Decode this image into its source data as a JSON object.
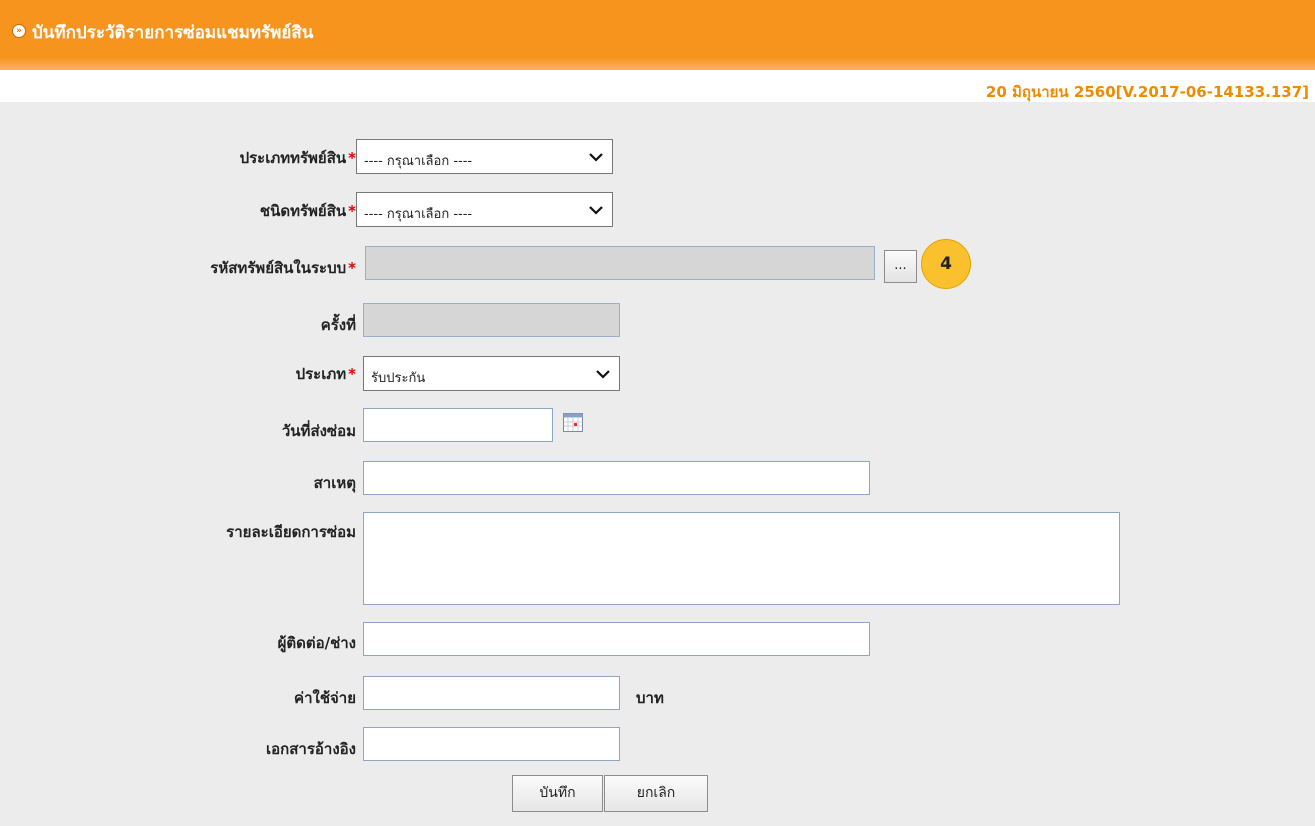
{
  "header": {
    "title": "บันทึกประวัติรายการซ่อมแชมทรัพย์สิน",
    "version": "20 มิถุนายน 2560[V.2017-06-14133.137]"
  },
  "form": {
    "asset_type": {
      "label": "ประเภททรัพย์สิน",
      "required_mark": "*",
      "value": "---- กรุณาเลือก ----"
    },
    "asset_kind": {
      "label": "ชนิดทรัพย์สิน",
      "required_mark": "*",
      "value": "---- กรุณาเลือก ----"
    },
    "asset_code": {
      "label": "รหัสทรัพย์สินในระบบ",
      "required_mark": "*",
      "value": "",
      "browse_label": "...",
      "step_badge": "4"
    },
    "times": {
      "label": "ครั้งที่",
      "value": ""
    },
    "category": {
      "label": "ประเภท",
      "required_mark": "*",
      "value": "รับประกัน"
    },
    "send_date": {
      "label": "วันที่ส่งซ่อม",
      "value": ""
    },
    "cause": {
      "label": "สาเหตุ",
      "value": ""
    },
    "repair_detail": {
      "label": "รายละเอียดการซ่อม",
      "value": ""
    },
    "contact": {
      "label": "ผู้ติดต่อ/ช่าง",
      "value": ""
    },
    "cost": {
      "label": "ค่าใช้จ่าย",
      "value": "",
      "unit": "บาท"
    },
    "reference_doc": {
      "label": "เอกสารอ้างอิง",
      "value": ""
    }
  },
  "actions": {
    "save_label": "บันทึก",
    "cancel_label": "ยกเลิก"
  },
  "colors": {
    "header": "#f7941d",
    "version_text": "#f08a00",
    "required": "#e00000",
    "badge": "#fbc02d"
  },
  "icons": {
    "header": "chevron-right-circle-icon",
    "calendar": "calendar-icon",
    "dropdown": "chevron-down-icon"
  }
}
